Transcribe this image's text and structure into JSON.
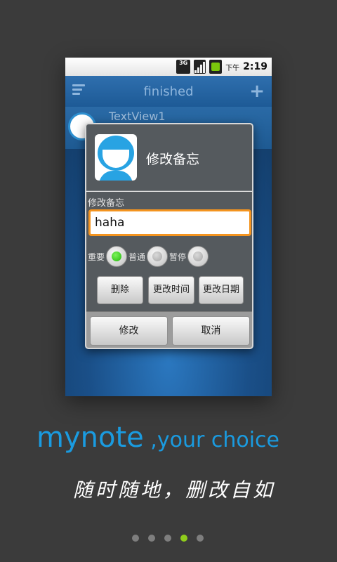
{
  "statusbar": {
    "network": "3G",
    "ampm": "下午",
    "time": "2:19"
  },
  "titlebar": {
    "title": "finished",
    "menu_icon": "list-menu-icon",
    "add_icon": "plus-icon",
    "add_label": "+"
  },
  "background_list": {
    "item_text": "TextView1"
  },
  "dialog": {
    "title": "修改备忘",
    "field_label": "修改备忘",
    "field_value": "haha",
    "priority": {
      "options": [
        "重要",
        "普通",
        "暂停"
      ],
      "selected": "重要"
    },
    "buttons": {
      "delete": "删除",
      "change_time": "更改时间",
      "change_date": "更改日期"
    },
    "footer": {
      "confirm": "修改",
      "cancel": "取消"
    }
  },
  "promo": {
    "title_main": "mynote",
    "title_suffix": " ,your choice",
    "subtitle": "随时随地，删改自如"
  },
  "pager": {
    "count": 5,
    "active_index": 3
  },
  "colors": {
    "accent": "#1a9be0",
    "focus_border": "#f4941f",
    "radio_checked": "#22b90c",
    "pager_active": "#8fcc1c"
  }
}
